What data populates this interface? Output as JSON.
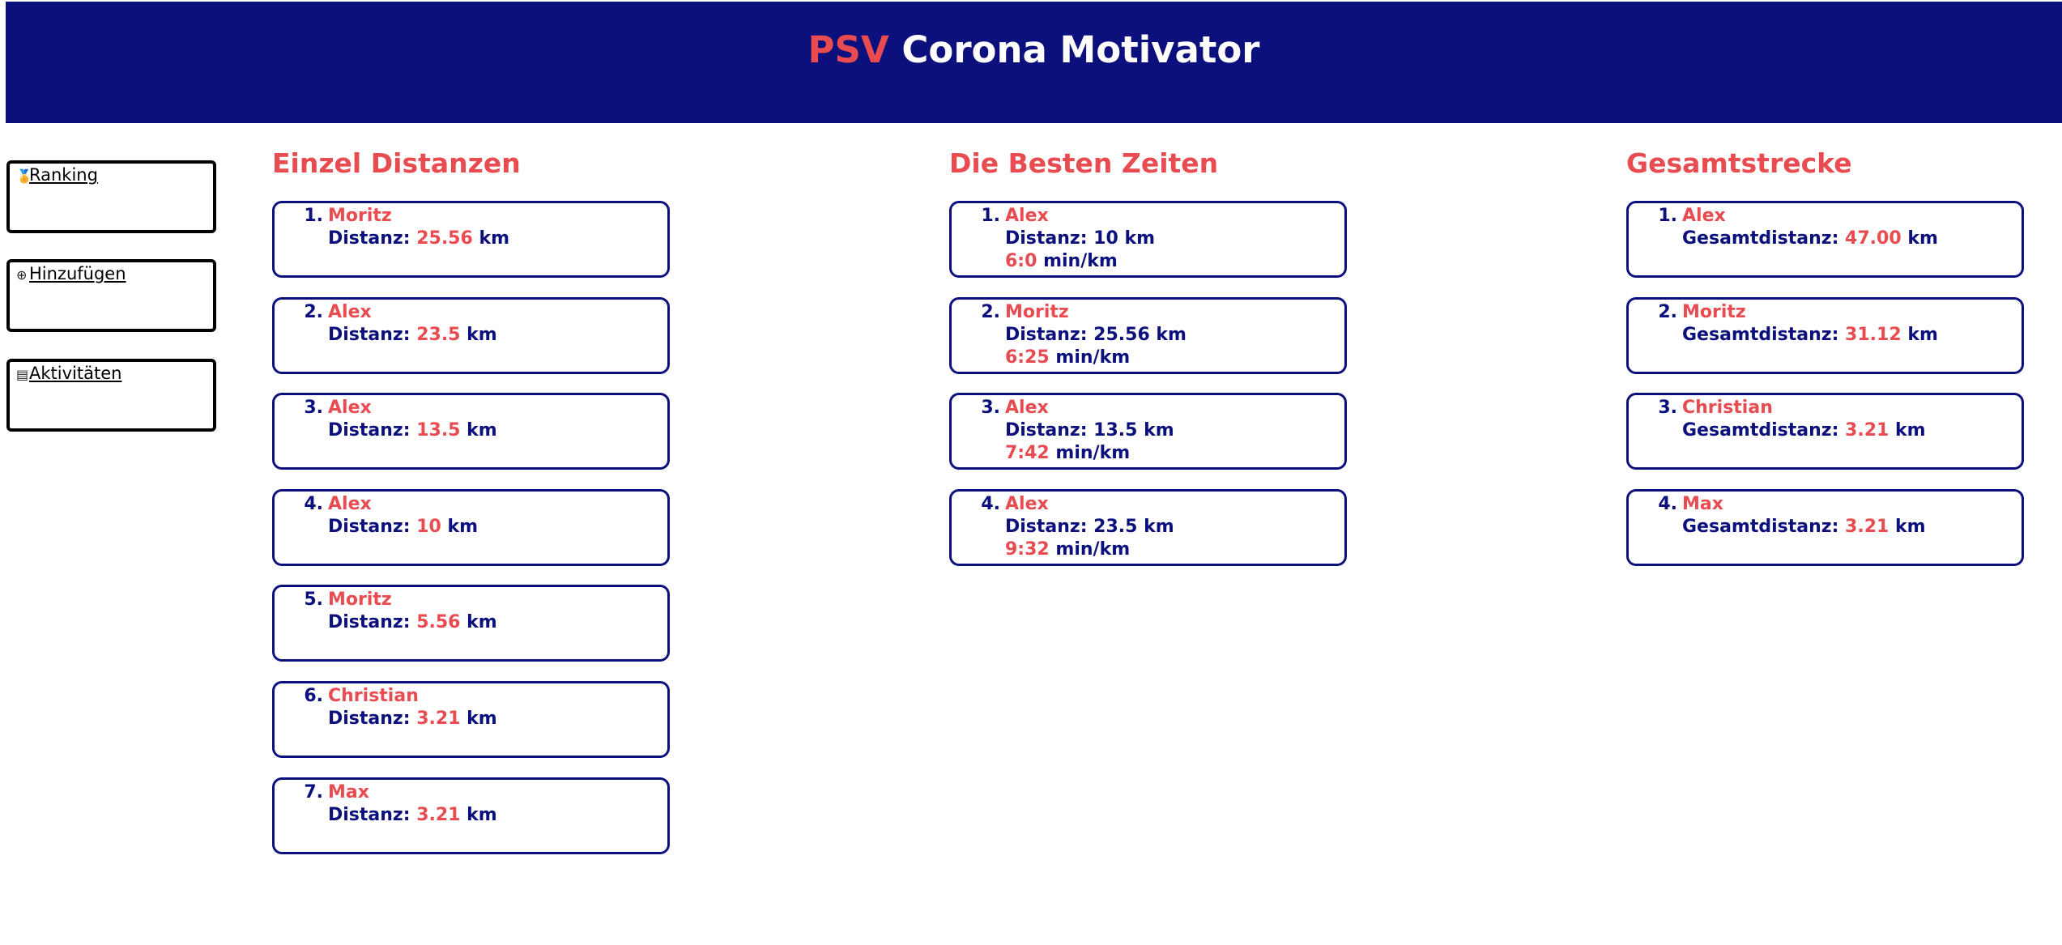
{
  "header": {
    "brand": "PSV",
    "title": "Corona Motivator"
  },
  "nav": [
    {
      "label": "Ranking",
      "icon": "ranking-icon",
      "glyph": "🏅"
    },
    {
      "label": "Hinzufügen",
      "icon": "add-circle-icon",
      "glyph": "⊕"
    },
    {
      "label": "Aktivitäten",
      "icon": "list-icon",
      "glyph": "▤"
    }
  ],
  "labels": {
    "distanz": "Distanz:",
    "gesamtdistanz": "Gesamtdistanz:",
    "km": "km",
    "pace_unit": "min/km"
  },
  "einzel": {
    "title": "Einzel Distanzen",
    "items": [
      {
        "rank": "1.",
        "name": "Moritz",
        "distance": "25.56"
      },
      {
        "rank": "2.",
        "name": "Alex",
        "distance": "23.5"
      },
      {
        "rank": "3.",
        "name": "Alex",
        "distance": "13.5"
      },
      {
        "rank": "4.",
        "name": "Alex",
        "distance": "10"
      },
      {
        "rank": "5.",
        "name": "Moritz",
        "distance": "5.56"
      },
      {
        "rank": "6.",
        "name": "Christian",
        "distance": "3.21"
      },
      {
        "rank": "7.",
        "name": "Max",
        "distance": "3.21"
      }
    ]
  },
  "zeiten": {
    "title": "Die Besten Zeiten",
    "items": [
      {
        "rank": "1.",
        "name": "Alex",
        "distance": "Distanz: 10 km",
        "pace": "6:0"
      },
      {
        "rank": "2.",
        "name": "Moritz",
        "distance": "Distanz: 25.56 km",
        "pace": "6:25"
      },
      {
        "rank": "3.",
        "name": "Alex",
        "distance": "Distanz: 13.5 km",
        "pace": "7:42"
      },
      {
        "rank": "4.",
        "name": "Alex",
        "distance": "Distanz: 23.5 km",
        "pace": "9:32"
      }
    ]
  },
  "gesamt": {
    "title": "Gesamtstrecke",
    "items": [
      {
        "rank": "1.",
        "name": "Alex",
        "total": "47.00"
      },
      {
        "rank": "2.",
        "name": "Moritz",
        "total": "31.12"
      },
      {
        "rank": "3.",
        "name": "Christian",
        "total": "3.21"
      },
      {
        "rank": "4.",
        "name": "Max",
        "total": "3.21"
      }
    ]
  },
  "colors": {
    "header_bg": "#0b107d",
    "accent_red": "#e84b50",
    "text_navy": "#0b107d"
  }
}
